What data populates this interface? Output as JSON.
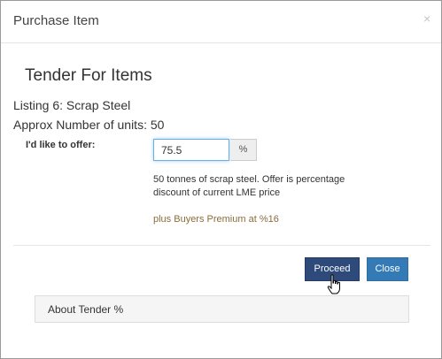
{
  "modal": {
    "title": "Purchase Item",
    "close_glyph": "×"
  },
  "tender": {
    "heading": "Tender For Items",
    "listing": "Listing 6: Scrap Steel",
    "units": "Approx Number of units: 50"
  },
  "offer": {
    "label": "I'd like to offer:",
    "value": "75.5",
    "addon": "%",
    "description": "50 tonnes of scrap steel. Offer is percentage discount of current LME price",
    "premium": "plus Buyers Premium at %16"
  },
  "actions": {
    "proceed_label": "Proceed",
    "close_label": "Close"
  },
  "panel": {
    "about_title": "About Tender %"
  },
  "colors": {
    "proceed": "#2e4a7a",
    "close": "#337ab7",
    "premium_text": "#8a6d3b",
    "input_focus": "#66afe9"
  },
  "icons": {
    "cursor": "hand-pointer-icon",
    "close": "close-icon"
  }
}
